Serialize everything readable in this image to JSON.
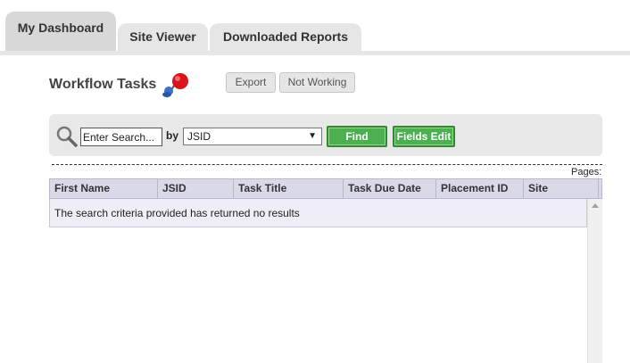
{
  "tabs": [
    {
      "label": "My Dashboard",
      "active": true
    },
    {
      "label": "Site Viewer",
      "active": false
    },
    {
      "label": "Downloaded Reports",
      "active": false
    }
  ],
  "header": {
    "title": "Workflow Tasks",
    "export_label": "Export",
    "not_working_label": "Not Working"
  },
  "search": {
    "value": "Enter Search...",
    "by_label": "by",
    "selected_field": "JSID",
    "find_label": "Find",
    "fields_edit_label": "Fields Edit"
  },
  "pager": {
    "label": "Pages:"
  },
  "grid": {
    "columns": [
      "First Name",
      "JSID",
      "Task Title",
      "Task Due Date",
      "Placement ID",
      "Site"
    ],
    "empty_message": "The search criteria provided has returned no results"
  },
  "colors": {
    "accent_green": "#4caf50",
    "grid_header": "#dad9e8",
    "panel_grey": "#e8e8e8"
  },
  "icons": {
    "title_icon": "pushpin-icon",
    "search_icon": "magnifier-icon"
  }
}
